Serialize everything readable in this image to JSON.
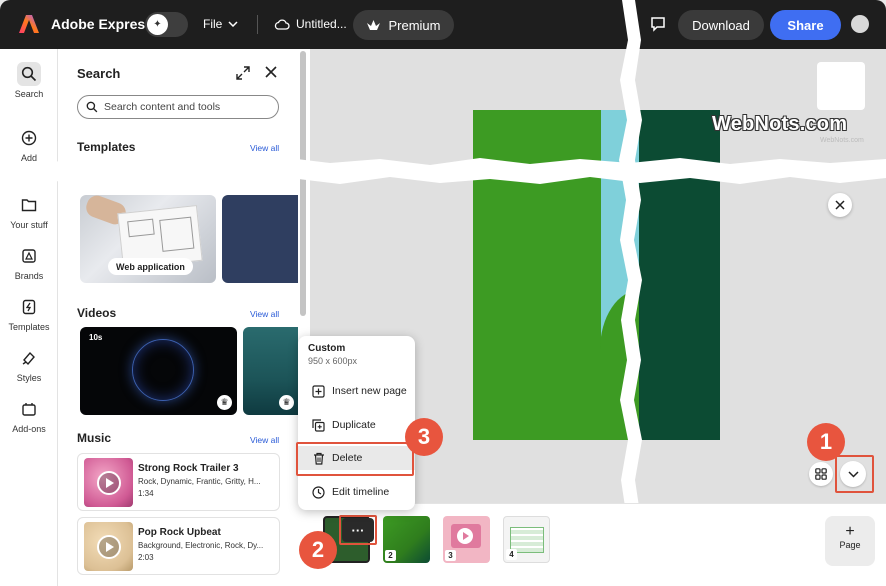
{
  "header": {
    "app_title": "Adobe Express",
    "file_label": "File",
    "doc_title": "Untitled...",
    "premium_label": "Premium",
    "download_label": "Download",
    "share_label": "Share"
  },
  "rail": {
    "items": [
      {
        "label": "Search",
        "icon": "search-icon"
      },
      {
        "label": "Add",
        "icon": "plus-circle-icon"
      },
      {
        "label": "Your stuff",
        "icon": "folder-icon"
      },
      {
        "label": "Brands",
        "icon": "brand-icon"
      },
      {
        "label": "Templates",
        "icon": "templates-icon"
      },
      {
        "label": "Styles",
        "icon": "styles-icon"
      },
      {
        "label": "Add-ons",
        "icon": "addons-icon"
      }
    ]
  },
  "panel": {
    "title": "Search",
    "search_placeholder": "Search content and tools",
    "templates_title": "Templates",
    "templates_view_all": "View all",
    "template_chip": "Web application",
    "videos_title": "Videos",
    "videos_view_all": "View all",
    "video_duration": "10s",
    "music_title": "Music",
    "music_view_all": "View all",
    "music": [
      {
        "name": "Strong Rock Trailer 3",
        "tags": "Rock, Dynamic, Frantic, Gritty, H...",
        "length": "1:34"
      },
      {
        "name": "Pop Rock Upbeat",
        "tags": "Background, Electronic, Rock, Dy...",
        "length": "2:03"
      }
    ]
  },
  "canvas": {
    "watermark": "WebNots.com",
    "watermark_small": "WebNots.com"
  },
  "context_menu": {
    "title": "Custom",
    "size": "950 x 600px",
    "items": [
      {
        "label": "Insert new page",
        "icon": "insert-page-icon"
      },
      {
        "label": "Duplicate",
        "icon": "duplicate-icon"
      },
      {
        "label": "Delete",
        "icon": "trash-icon"
      },
      {
        "label": "Edit timeline",
        "icon": "clock-icon"
      }
    ]
  },
  "pages": {
    "more_label": "···",
    "numbers": [
      "2",
      "3",
      "4"
    ],
    "add_page_label": "Page",
    "add_page_plus": "+"
  },
  "steps": [
    "1",
    "2",
    "3"
  ],
  "colors": {
    "accent": "#3f6ef2",
    "step_red": "#e8553e",
    "topbar": "#1e1e1e",
    "art_green": "#3d9b23",
    "art_dark": "#0c4b33",
    "art_cyan": "#7fd0da"
  }
}
